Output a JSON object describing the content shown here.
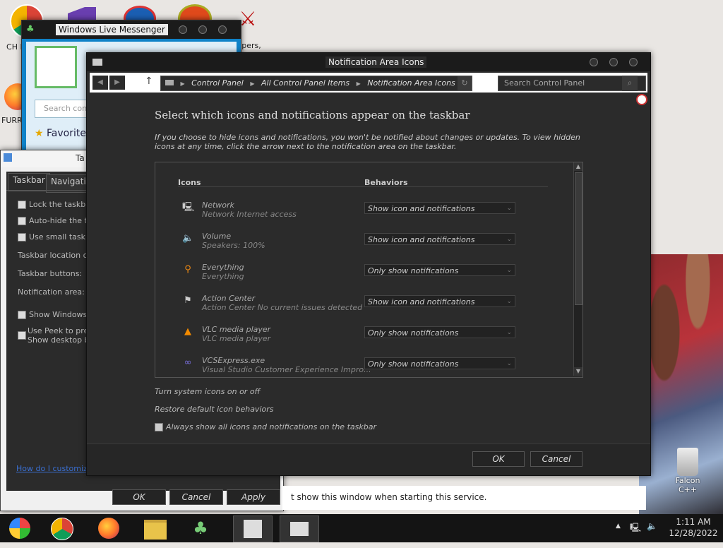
{
  "desktop": {
    "icons": [
      {
        "label": "CH D",
        "icon": "chrome-icon"
      },
      {
        "label": "FURR",
        "icon": "firefox-icon"
      },
      {
        "label": "pers,",
        "icon": "app-icon"
      },
      {
        "label": "Falcon C++",
        "icon": "recycle-bin-icon"
      }
    ]
  },
  "messenger": {
    "title": "Windows Live Messenger",
    "search_placeholder": "Search cont",
    "favorites_label": "Favorite"
  },
  "taskbar_props": {
    "title": "Ta",
    "tabs": [
      "Taskbar",
      "Navigatio"
    ],
    "rows": {
      "lock": "Lock the taskbar",
      "autohide": "Auto-hide the tas",
      "small": "Use small taskbar",
      "location": "Taskbar location on s",
      "buttons": "Taskbar buttons:",
      "notif": "Notification area:",
      "show_windows": "Show Windows St",
      "peek1": "Use Peek to previ",
      "peek2": "Show desktop bu"
    },
    "help_link": "How do I customize",
    "ok": "OK",
    "cancel": "Cancel",
    "apply": "Apply"
  },
  "service_notice": "t show this window when starting this service.",
  "main": {
    "title": "Notification Area Icons",
    "breadcrumb": [
      "Control Panel",
      "All Control Panel Items",
      "Notification Area Icons"
    ],
    "search_placeholder": "Search Control Panel",
    "heading": "Select which icons and notifications appear on the taskbar",
    "description": "If you choose to hide icons and notifications, you won't be notified about changes or updates. To view hidden icons at any time, click the arrow next to the notification area on the taskbar.",
    "col_icons": "Icons",
    "col_behaviors": "Behaviors",
    "rows": [
      {
        "name": "Network",
        "sub": "Network Internet access",
        "behavior": "Show icon and notifications",
        "icon": "network-icon"
      },
      {
        "name": "Volume",
        "sub": "Speakers: 100%",
        "behavior": "Show icon and notifications",
        "icon": "volume-icon"
      },
      {
        "name": "Everything",
        "sub": "Everything",
        "behavior": "Only show notifications",
        "icon": "search-icon"
      },
      {
        "name": "Action Center",
        "sub": "Action Center  No current issues detected",
        "behavior": "Show icon and notifications",
        "icon": "flag-icon"
      },
      {
        "name": "VLC media player",
        "sub": "VLC media player",
        "behavior": "Only show notifications",
        "icon": "vlc-icon"
      },
      {
        "name": "VCSExpress.exe",
        "sub": "Visual Studio Customer Experience Impro...",
        "behavior": "Only show notifications",
        "icon": "infinity-icon"
      }
    ],
    "link_system_icons": "Turn system icons on or off",
    "link_restore": "Restore default icon behaviors",
    "always_show": "Always show all icons and notifications on the taskbar",
    "ok": "OK",
    "cancel": "Cancel"
  },
  "taskbar": {
    "time": "1:11 AM",
    "date": "12/28/2022"
  }
}
